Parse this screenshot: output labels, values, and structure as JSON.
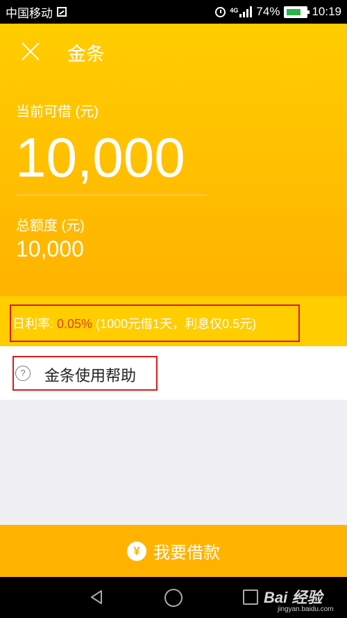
{
  "status_bar": {
    "carrier": "中国移动",
    "network": "4G",
    "battery": "74%",
    "time": "10:19"
  },
  "header": {
    "title": "金条",
    "available_label": "当前可借 (元)",
    "available_amount": "10,000",
    "total_label": "总额度 (元)",
    "total_amount": "10,000"
  },
  "rate": {
    "label": "日利率: ",
    "value": "0.05%",
    "note": " (1000元借1天，利息仅0.5元)"
  },
  "help": {
    "icon_glyph": "?",
    "label": "金条使用帮助"
  },
  "borrow_button": {
    "icon_glyph": "¥",
    "label": "我要借款"
  },
  "watermark": {
    "brand": "Bai 经验",
    "url": "jingyan.baidu.com"
  },
  "colors": {
    "brand_yellow": "#ffcd00",
    "button_orange": "#ffb300",
    "rate_red": "#d2451e",
    "annotation_red": "#e0161b",
    "page_bg": "#efeff4"
  }
}
